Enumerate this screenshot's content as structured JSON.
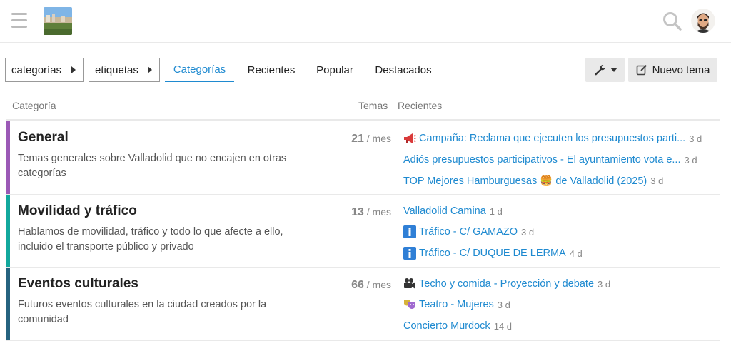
{
  "header": {
    "menu_icon": "hamburger-icon",
    "logo": "site-logo",
    "search_icon": "search-icon",
    "avatar": "user-avatar"
  },
  "nav": {
    "categories_dropdown": "categorías",
    "tags_dropdown": "etiquetas",
    "tabs": [
      "Categorías",
      "Recientes",
      "Popular",
      "Destacados"
    ],
    "active_tab": "Categorías",
    "new_topic": "Nuevo tema"
  },
  "table": {
    "col_category": "Categoría",
    "col_topics": "Temas",
    "col_recent": "Recientes"
  },
  "categories": [
    {
      "name": "General",
      "description": "Temas generales sobre Valladolid que no encajen en otras categorías",
      "count": "21",
      "period": "/ mes",
      "color": "#9b59b6",
      "topics": [
        {
          "title": "Campaña: Reclama que ejecuten los presupuestos parti...",
          "age": "3 d",
          "icon": "megaphone-icon"
        },
        {
          "title": "Adiós presupuestos participativos - El ayuntamiento vota e...",
          "age": "3 d",
          "icon": ""
        },
        {
          "title": "TOP Mejores Hamburguesas 🍔 de Valladolid (2025)",
          "age": "3 d",
          "icon": ""
        }
      ]
    },
    {
      "name": "Movilidad y tráfico",
      "description": "Hablamos de movilidad, tráfico y todo lo que afecte a ello, incluido el transporte público y privado",
      "count": "13",
      "period": "/ mes",
      "color": "#12a89d",
      "topics": [
        {
          "title": "Valladolid Camina",
          "age": "1 d",
          "icon": ""
        },
        {
          "title": "Tráfico - C/ GAMAZO",
          "age": "3 d",
          "icon": "info-icon"
        },
        {
          "title": "Tráfico - C/ DUQUE DE LERMA",
          "age": "4 d",
          "icon": "info-icon"
        }
      ]
    },
    {
      "name": "Eventos culturales",
      "description": "Futuros eventos culturales en la ciudad creados por la comunidad",
      "count": "66",
      "period": "/ mes",
      "color": "#25637f",
      "topics": [
        {
          "title": "Techo y comida - Proyección y debate",
          "age": "3 d",
          "icon": "film-camera-icon"
        },
        {
          "title": "Teatro - Mujeres",
          "age": "3 d",
          "icon": "theater-masks-icon"
        },
        {
          "title": "Concierto Murdock",
          "age": "14 d",
          "icon": ""
        }
      ]
    }
  ]
}
